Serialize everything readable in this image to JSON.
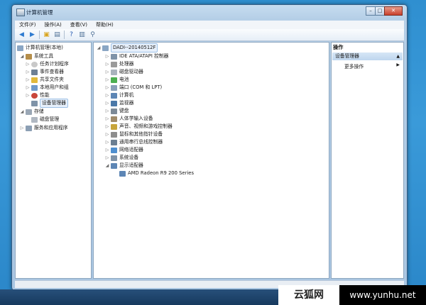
{
  "window": {
    "title": "计算机管理",
    "minimize": "–",
    "maximize": "□",
    "close": "✕"
  },
  "menu": [
    "文件(F)",
    "操作(A)",
    "查看(V)",
    "帮助(H)"
  ],
  "toolbar": [
    "back-arrow-icon",
    "forward-arrow-icon",
    "folder-up-icon",
    "console-tree-icon",
    "help-icon",
    "properties-icon",
    "device-scan-icon"
  ],
  "left_tree": {
    "root": "计算机管理(本地)",
    "system_tools": "系统工具",
    "task_scheduler": "任务计划程序",
    "event_viewer": "事件查看器",
    "shared_folders": "共享文件夹",
    "local_users": "本地用户和组",
    "performance": "性能",
    "device_manager": "设备管理器",
    "storage": "存储",
    "disk_management": "磁盘管理",
    "services_apps": "服务和应用程序"
  },
  "device_tree": {
    "computer_name": "DADI--20140512F",
    "categories": [
      "IDE ATA/ATAPI 控制器",
      "处理器",
      "磁盘驱动器",
      "电池",
      "端口 (COM 和 LPT)",
      "计算机",
      "监视器",
      "键盘",
      "人体学输入设备",
      "声音、视频和游戏控制器",
      "鼠标和其他指针设备",
      "通用串行总线控制器",
      "网络适配器",
      "系统设备",
      "显示适配器"
    ],
    "display_adapter_child": "AMD Radeon R9 200 Series"
  },
  "actions": {
    "header": "操作",
    "section": "设备管理器",
    "more": "更多操作"
  },
  "watermark": {
    "left": "云狐网",
    "right": "www.yunhu.net"
  }
}
